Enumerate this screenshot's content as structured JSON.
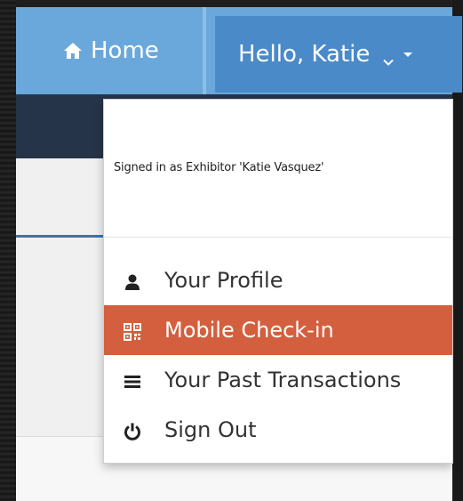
{
  "navbar": {
    "home_label": "Home",
    "home_icon": "home-icon",
    "user_menu_label": "Hello, Katie",
    "colors": {
      "nav_blue": "#6aa8dc",
      "user_button": "#4a8ac9",
      "nav_dark": "#26344a"
    }
  },
  "dropdown": {
    "signed_in_text": "Signed in as Exhibitor 'Katie Vasquez'",
    "items": [
      {
        "label": "Your Profile",
        "icon": "user-icon",
        "active": false
      },
      {
        "label": "Mobile Check-in",
        "icon": "qrcode-icon",
        "active": true
      },
      {
        "label": "Your Past Transactions",
        "icon": "list-icon",
        "active": false
      },
      {
        "label": "Sign Out",
        "icon": "power-icon",
        "active": false
      }
    ],
    "colors": {
      "active_bg": "#d35f3e"
    }
  }
}
